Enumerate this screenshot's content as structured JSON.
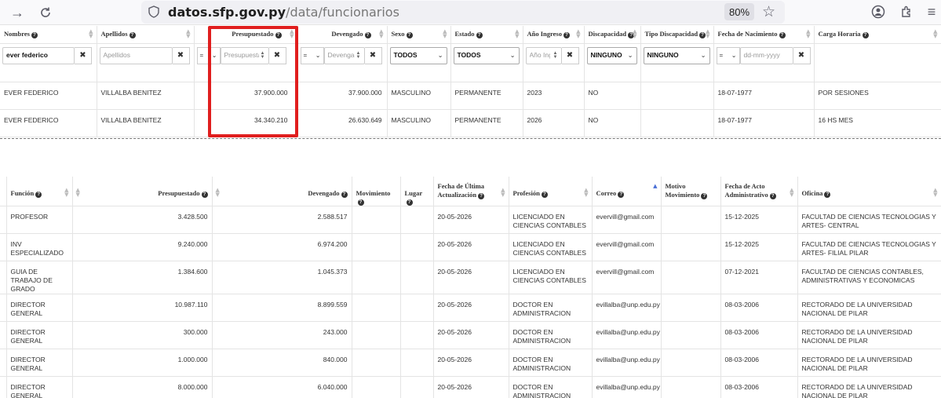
{
  "browser": {
    "url_host": "datos.sfp.gov.py",
    "url_path": "/data/funcionarios",
    "zoom": "80%",
    "back_icon": "back-arrow-icon",
    "reload_icon": "reload-icon"
  },
  "top_table": {
    "headers": [
      "Nombres",
      "Apellidos",
      "Presupuestado",
      "Devengado",
      "Sexo",
      "Estado",
      "Año Ingreso",
      "Discapacidad",
      "Tipo Discapacidad",
      "Fecha de Nacimiento",
      "Carga Horaria"
    ],
    "filters": {
      "nombres_value": "ever federico",
      "apellidos_placeholder": "Apellidos",
      "op_equal": "=",
      "presupuestado_placeholder": "Presupuestado",
      "devengado_placeholder": "Devengado",
      "sexo_selected": "TODOS",
      "estado_selected": "TODOS",
      "anio_placeholder": "Año Ingreso",
      "discapacidad_selected": "NINGUNO",
      "tipo_discapacidad_selected": "NINGUNO",
      "fecha_placeholder": "dd-mm-yyyy"
    },
    "rows": [
      {
        "nombres": "EVER FEDERICO",
        "apellidos": "VILLALBA BENITEZ",
        "presupuestado": "37.900.000",
        "devengado": "37.900.000",
        "sexo": "MASCULINO",
        "estado": "PERMANENTE",
        "anio": "2023",
        "discapacidad": "NO",
        "tipo": "",
        "fecha": "18-07-1977",
        "carga": "POR SESIONES"
      },
      {
        "nombres": "EVER FEDERICO",
        "apellidos": "VILLALBA BENITEZ",
        "presupuestado": "34.340.210",
        "devengado": "26.630.649",
        "sexo": "MASCULINO",
        "estado": "PERMANENTE",
        "anio": "2026",
        "discapacidad": "NO",
        "tipo": "",
        "fecha": "18-07-1977",
        "carga": "16 HS MES"
      }
    ]
  },
  "bottom_table": {
    "headers": {
      "funcion": "Función",
      "presupuestado": "Presupuestado",
      "devengado": "Devengado",
      "movimiento": "Movimiento",
      "lugar": "Lugar",
      "fecha_act_1": "Fecha de Última",
      "fecha_act_2": "Actualización",
      "profesion": "Profesión",
      "correo": "Correo",
      "motivo_1": "Motivo",
      "motivo_2": "Movimiento",
      "acto_1": "Fecha de Acto",
      "acto_2": "Administrativo",
      "oficina": "Oficina"
    },
    "rows": [
      {
        "funcion": "PROFESOR",
        "presupuestado": "3.428.500",
        "devengado": "2.588.517",
        "fecha": "20-05-2026",
        "profesion": "LICENCIADO EN CIENCIAS CONTABLES",
        "correo": "evervill@gmail.com",
        "acto": "15-12-2025",
        "oficina": "FACULTAD DE CIENCIAS TECNOLOGIAS Y ARTES- CENTRAL"
      },
      {
        "funcion": "INV ESPECIALIZADO",
        "presupuestado": "9.240.000",
        "devengado": "6.974.200",
        "fecha": "20-05-2026",
        "profesion": "LICENCIADO EN CIENCIAS CONTABLES",
        "correo": "evervill@gmail.com",
        "acto": "15-12-2025",
        "oficina": "FACULTAD DE CIENCIAS TECNOLOGIAS Y ARTES- FILIAL PILAR"
      },
      {
        "funcion": "GUIA DE TRABAJO DE GRADO",
        "presupuestado": "1.384.600",
        "devengado": "1.045.373",
        "fecha": "20-05-2026",
        "profesion": "LICENCIADO EN CIENCIAS CONTABLES",
        "correo": "evervill@gmail.com",
        "acto": "07-12-2021",
        "oficina": "FACULTAD DE CIENCIAS CONTABLES, ADMINISTRATIVAS Y ECONOMICAS"
      },
      {
        "funcion": "DIRECTOR GENERAL",
        "presupuestado": "10.987.110",
        "devengado": "8.899.559",
        "fecha": "20-05-2026",
        "profesion": "DOCTOR EN ADMINISTRACION",
        "correo": "evillalba@unp.edu.py",
        "acto": "08-03-2006",
        "oficina": "RECTORADO DE LA UNIVERSIDAD NACIONAL DE PILAR"
      },
      {
        "funcion": "DIRECTOR GENERAL",
        "presupuestado": "300.000",
        "devengado": "243.000",
        "fecha": "20-05-2026",
        "profesion": "DOCTOR EN ADMINISTRACION",
        "correo": "evillalba@unp.edu.py",
        "acto": "08-03-2006",
        "oficina": "RECTORADO DE LA UNIVERSIDAD NACIONAL DE PILAR"
      },
      {
        "funcion": "DIRECTOR GENERAL",
        "presupuestado": "1.000.000",
        "devengado": "840.000",
        "fecha": "20-05-2026",
        "profesion": "DOCTOR EN ADMINISTRACION",
        "correo": "evillalba@unp.edu.py",
        "acto": "08-03-2006",
        "oficina": "RECTORADO DE LA UNIVERSIDAD NACIONAL DE PILAR"
      },
      {
        "funcion": "DIRECTOR GENERAL",
        "presupuestado": "8.000.000",
        "devengado": "6.040.000",
        "fecha": "20-05-2026",
        "profesion": "DOCTOR EN ADMINISTRACION",
        "correo": "evillalba@unp.edu.py",
        "acto": "08-03-2006",
        "oficina": "RECTORADO DE LA UNIVERSIDAD NACIONAL DE PILAR"
      }
    ]
  },
  "colors": {
    "highlight": "#e01e1e",
    "sort_active": "#4a6fd6"
  }
}
